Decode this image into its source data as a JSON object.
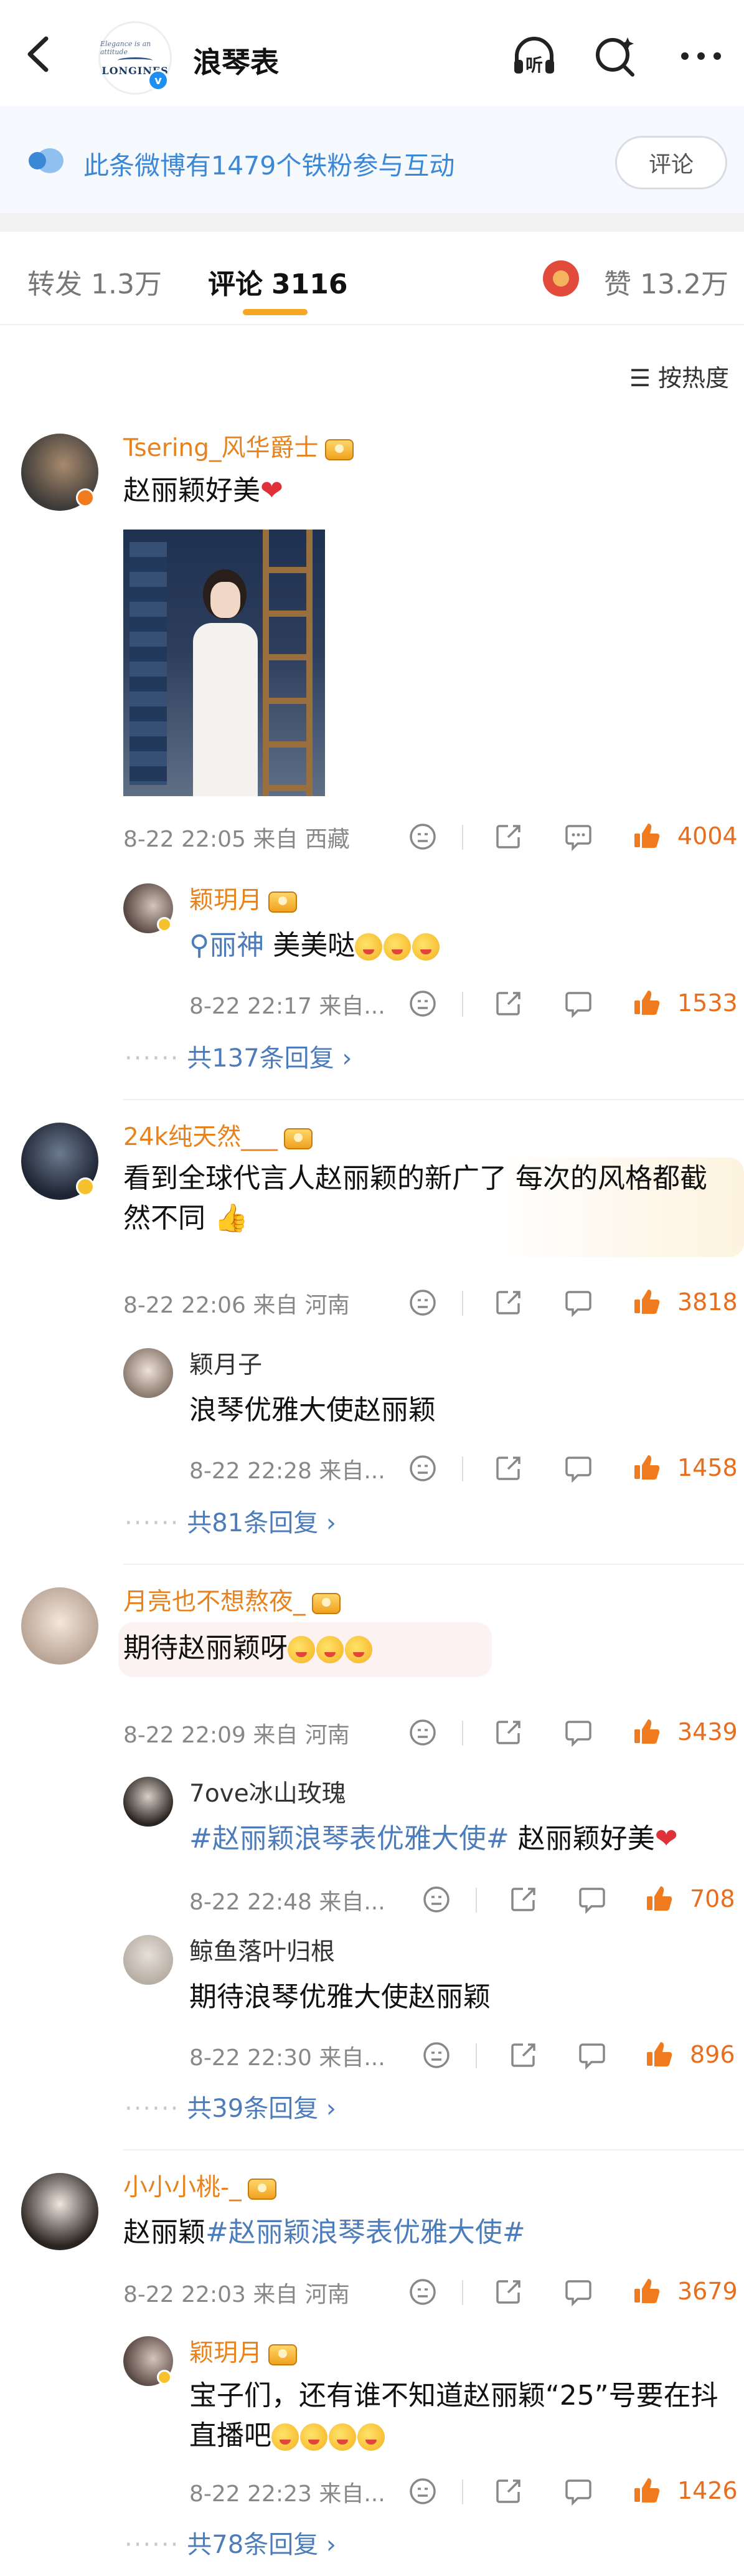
{
  "header": {
    "account_name": "浪琴表",
    "logo_text": "LONGINES",
    "logo_script": "Elegance is an attitude",
    "listen_label": "听"
  },
  "banner": {
    "text": "此条微博有1479个铁粉参与互动",
    "button": "评论"
  },
  "tabs": {
    "repost": "转发 1.3万",
    "comment_label": "评论",
    "comment_count": "3116",
    "like": "赞 13.2万"
  },
  "sort_label": "按热度",
  "comments": [
    {
      "user": "Tsering_风华爵士",
      "text": "赵丽颖好美",
      "time": "8-22 22:05",
      "location": "来自 西藏",
      "likes": "4004",
      "replies": [
        {
          "user": "颖玥月",
          "mention": "丽神",
          "text": "美美哒",
          "time": "8-22 22:17",
          "location": "来自...",
          "likes": "1533"
        }
      ],
      "more": "共137条回复"
    },
    {
      "user": "24k纯天然___",
      "text": "看到全球代言人赵丽颖的新广了 每次的风格都截然不同",
      "time": "8-22 22:06",
      "location": "来自 河南",
      "likes": "3818",
      "replies": [
        {
          "user": "颖月子",
          "text": "浪琴优雅大使赵丽颖",
          "time": "8-22 22:28",
          "location": "来自...",
          "likes": "1458"
        }
      ],
      "more": "共81条回复"
    },
    {
      "user": "月亮也不想熬夜_",
      "text": "期待赵丽颖呀",
      "time": "8-22 22:09",
      "location": "来自 河南",
      "likes": "3439",
      "replies": [
        {
          "user": "7ove冰山玫瑰",
          "topic": "#赵丽颖浪琴表优雅大使#",
          "text": "赵丽颖好美",
          "time": "8-22 22:48",
          "location": "来自...",
          "likes": "708"
        },
        {
          "user": "鲸鱼落叶归根",
          "text": "期待浪琴优雅大使赵丽颖",
          "time": "8-22 22:30",
          "location": "来自...",
          "likes": "896"
        }
      ],
      "more": "共39条回复"
    },
    {
      "user": "小小小桃-_",
      "text": "赵丽颖",
      "topic": "#赵丽颖浪琴表优雅大使#",
      "time": "8-22 22:03",
      "location": "来自 河南",
      "likes": "3679",
      "replies": [
        {
          "user": "颖玥月",
          "text": "宝子们，还有谁不知道赵丽颖“25”号要在抖直播吧",
          "time": "8-22 22:23",
          "location": "来自...",
          "likes": "1426"
        }
      ],
      "more": "共78条回复"
    }
  ],
  "colors": {
    "accent": "#e8821d",
    "link": "#4d7cbb",
    "like": "#e86e1e",
    "tab_underline": "#f6a623"
  },
  "icons": [
    "back-arrow-icon",
    "listen-icon",
    "search-icon",
    "more-icon",
    "chat-icon",
    "dislike-icon",
    "share-icon",
    "comment-icon",
    "thumb-up-icon",
    "sort-icon"
  ]
}
